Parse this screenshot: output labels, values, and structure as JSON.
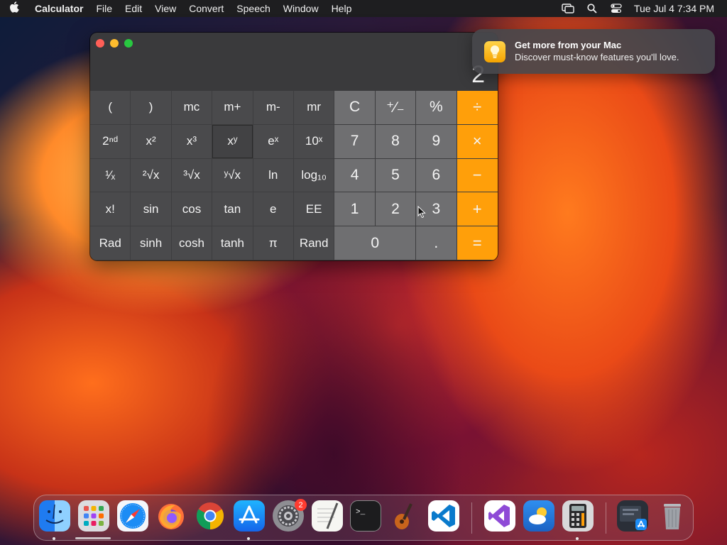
{
  "menubar": {
    "app_name": "Calculator",
    "menus": [
      "File",
      "Edit",
      "View",
      "Convert",
      "Speech",
      "Window",
      "Help"
    ],
    "clock": "Tue Jul 4  7:34 PM"
  },
  "calculator": {
    "display": "2",
    "keys": [
      {
        "label": "(",
        "kind": "sci"
      },
      {
        "label": ")",
        "kind": "sci"
      },
      {
        "label": "mc",
        "kind": "sci"
      },
      {
        "label": "m+",
        "kind": "sci"
      },
      {
        "label": "m-",
        "kind": "sci"
      },
      {
        "label": "mr",
        "kind": "sci"
      },
      {
        "label": "C",
        "kind": "num"
      },
      {
        "label": "⁺∕₋",
        "kind": "num"
      },
      {
        "label": "%",
        "kind": "num"
      },
      {
        "label": "÷",
        "kind": "op"
      },
      {
        "label": "2ⁿᵈ",
        "kind": "sci"
      },
      {
        "label": "x²",
        "kind": "sci"
      },
      {
        "label": "x³",
        "kind": "sci"
      },
      {
        "label": "xʸ",
        "kind": "sci"
      },
      {
        "label": "eˣ",
        "kind": "sci"
      },
      {
        "label": "10ˣ",
        "kind": "sci"
      },
      {
        "label": "7",
        "kind": "num"
      },
      {
        "label": "8",
        "kind": "num"
      },
      {
        "label": "9",
        "kind": "num"
      },
      {
        "label": "×",
        "kind": "op"
      },
      {
        "label": "¹⁄ₓ",
        "kind": "sci"
      },
      {
        "label": "²√x",
        "kind": "sci"
      },
      {
        "label": "³√x",
        "kind": "sci"
      },
      {
        "label": "ʸ√x",
        "kind": "sci"
      },
      {
        "label": "ln",
        "kind": "sci"
      },
      {
        "label": "log₁₀",
        "kind": "sci"
      },
      {
        "label": "4",
        "kind": "num"
      },
      {
        "label": "5",
        "kind": "num"
      },
      {
        "label": "6",
        "kind": "num"
      },
      {
        "label": "−",
        "kind": "op"
      },
      {
        "label": "x!",
        "kind": "sci"
      },
      {
        "label": "sin",
        "kind": "sci"
      },
      {
        "label": "cos",
        "kind": "sci"
      },
      {
        "label": "tan",
        "kind": "sci"
      },
      {
        "label": "e",
        "kind": "sci"
      },
      {
        "label": "EE",
        "kind": "sci"
      },
      {
        "label": "1",
        "kind": "num"
      },
      {
        "label": "2",
        "kind": "num"
      },
      {
        "label": "3",
        "kind": "num"
      },
      {
        "label": "+",
        "kind": "op"
      },
      {
        "label": "Rad",
        "kind": "sci"
      },
      {
        "label": "sinh",
        "kind": "sci"
      },
      {
        "label": "cosh",
        "kind": "sci"
      },
      {
        "label": "tanh",
        "kind": "sci"
      },
      {
        "label": "π",
        "kind": "sci"
      },
      {
        "label": "Rand",
        "kind": "sci"
      },
      {
        "label": "0",
        "kind": "num"
      },
      {
        "label": ".",
        "kind": "num"
      },
      {
        "label": "=",
        "kind": "op"
      }
    ]
  },
  "notification": {
    "title": "Get more from your Mac",
    "body": "Discover must-know features you'll love."
  },
  "dock": {
    "settings_badge": "2",
    "apps": [
      {
        "name": "Finder",
        "icon": "finder-icon",
        "color": "#3a8ef6"
      },
      {
        "name": "Launchpad",
        "icon": "launchpad-icon",
        "color": "#d9d9de"
      },
      {
        "name": "Safari",
        "icon": "safari-icon",
        "color": "#1e88ff"
      },
      {
        "name": "Firefox",
        "icon": "firefox-icon",
        "color": "#ff6f1f"
      },
      {
        "name": "Chrome",
        "icon": "chrome-icon",
        "color": "#f2f2f2"
      },
      {
        "name": "App Store",
        "icon": "app-store-icon",
        "color": "#1c8cf5"
      },
      {
        "name": "System Settings",
        "icon": "system-settings-icon",
        "color": "#8e8e93"
      },
      {
        "name": "TextEdit",
        "icon": "textedit-icon",
        "color": "#f6f6f2"
      },
      {
        "name": "Terminal",
        "icon": "terminal-icon",
        "color": "#1c1c1e"
      },
      {
        "name": "GarageBand",
        "icon": "garageband-icon",
        "color": "#3b2a22"
      },
      {
        "name": "VS Code",
        "icon": "vscode-icon",
        "color": "#ffffff"
      },
      {
        "name": "Visual Studio",
        "icon": "visual-studio-icon",
        "color": "#ffffff"
      },
      {
        "name": "Weather",
        "icon": "weather-icon",
        "color": "#2b7ee3"
      },
      {
        "name": "Calculator",
        "icon": "calculator-icon",
        "color": "#d8d8da"
      },
      {
        "name": "App Store Folder",
        "icon": "downloads-stack-icon",
        "color": "#4a5260"
      },
      {
        "name": "Trash",
        "icon": "trash-icon",
        "color": "#9ea2a8"
      }
    ]
  }
}
